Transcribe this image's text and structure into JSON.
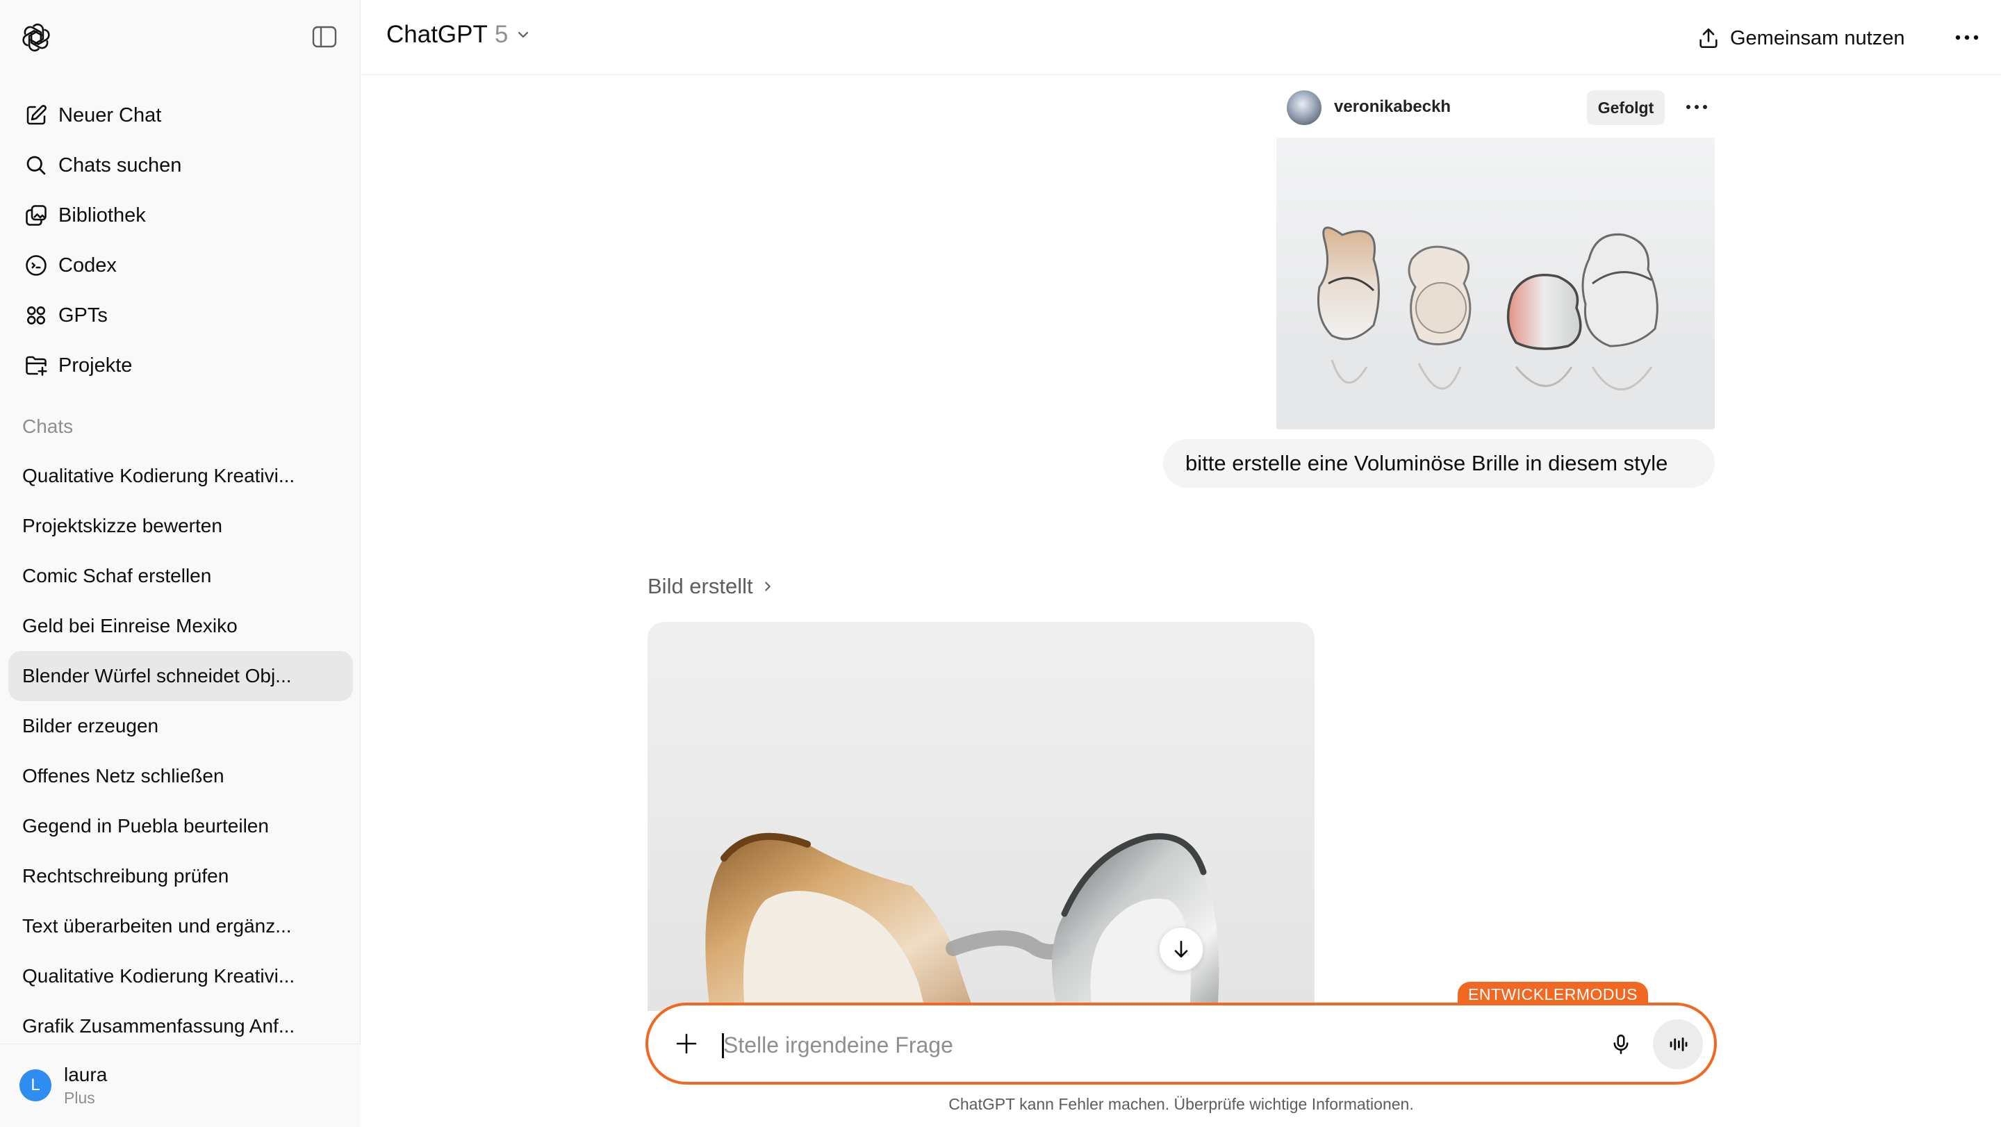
{
  "header": {
    "model_name": "ChatGPT",
    "model_version": "5",
    "share_label": "Gemeinsam nutzen"
  },
  "sidebar": {
    "nav": [
      {
        "label": "Neuer Chat",
        "icon": "edit-icon"
      },
      {
        "label": "Chats suchen",
        "icon": "search-icon"
      },
      {
        "label": "Bibliothek",
        "icon": "library-icon"
      },
      {
        "label": "Codex",
        "icon": "codex-icon"
      },
      {
        "label": "GPTs",
        "icon": "grid-icon"
      },
      {
        "label": "Projekte",
        "icon": "folder-plus-icon"
      }
    ],
    "section_label": "Chats",
    "chats": [
      "Qualitative Kodierung Kreativi...",
      "Projektskizze bewerten",
      "Comic Schaf erstellen",
      "Geld bei Einreise Mexiko",
      "Blender Würfel schneidet Obj...",
      "Bilder erzeugen",
      "Offenes Netz schließen",
      "Gegend in Puebla beurteilen",
      "Rechtschreibung prüfen",
      "Text überarbeiten und ergänz...",
      "Qualitative Kodierung Kreativi...",
      "Grafik Zusammenfassung Anf..."
    ],
    "active_chat_index": 4,
    "user": {
      "initial": "L",
      "name": "laura",
      "plan": "Plus"
    }
  },
  "conversation": {
    "attachment": {
      "username": "veronikabeckh",
      "follow_label": "Gefolgt"
    },
    "user_message": "bitte erstelle eine Voluminöse Brille in diesem style",
    "assistant_status": "Bild erstellt"
  },
  "composer": {
    "badge": "ENTWICKLERMODUS",
    "placeholder": "Stelle irgendeine Frage",
    "value": ""
  },
  "disclaimer": "ChatGPT kann Fehler machen. Überprüfe wichtige Informationen.",
  "colors": {
    "accent": "#f26722",
    "sidebar_bg": "#f9f9f9",
    "active_item_bg": "#e8e8e8",
    "bubble_bg": "#f4f4f4",
    "avatar_bg": "#2f8cf0"
  }
}
